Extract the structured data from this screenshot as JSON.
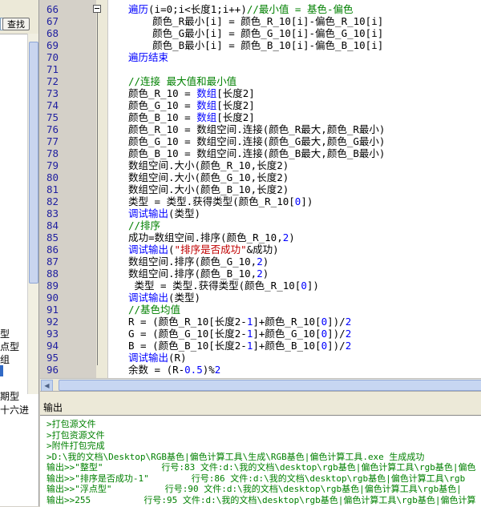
{
  "left_panel": {
    "find_button": "查找",
    "tree_items": [
      "型",
      "点型",
      "组",
      "",
      "",
      "期型",
      "十六进"
    ]
  },
  "editor": {
    "lines": [
      {
        "no": "66",
        "segs": [
          {
            "t": "遍历",
            "c": "kw"
          },
          {
            "t": "(i=0;i<长度1;i++)",
            "c": "plain"
          },
          {
            "t": "//最小值 = 基色-偏色",
            "c": "comment"
          }
        ]
      },
      {
        "no": "67",
        "segs": [
          {
            "t": "    颜色_R最小[i] = 颜色_R_10[i]-偏色_R_10[i]",
            "c": "plain"
          }
        ]
      },
      {
        "no": "68",
        "segs": [
          {
            "t": "    颜色_G最小[i] = 颜色_G_10[i]-偏色_G_10[i]",
            "c": "plain"
          }
        ]
      },
      {
        "no": "69",
        "segs": [
          {
            "t": "    颜色_B最小[i] = 颜色_B_10[i]-偏色_B_10[i]",
            "c": "plain"
          }
        ]
      },
      {
        "no": "70",
        "segs": [
          {
            "t": "遍历结束",
            "c": "kw"
          }
        ]
      },
      {
        "no": "71",
        "segs": []
      },
      {
        "no": "72",
        "segs": [
          {
            "t": "//连接 最大值和最小值",
            "c": "comment"
          }
        ]
      },
      {
        "no": "73",
        "segs": [
          {
            "t": "颜色_R_10 = ",
            "c": "plain"
          },
          {
            "t": "数组",
            "c": "kw"
          },
          {
            "t": "[长度2]",
            "c": "plain"
          }
        ]
      },
      {
        "no": "74",
        "segs": [
          {
            "t": "颜色_G_10 = ",
            "c": "plain"
          },
          {
            "t": "数组",
            "c": "kw"
          },
          {
            "t": "[长度2]",
            "c": "plain"
          }
        ]
      },
      {
        "no": "75",
        "segs": [
          {
            "t": "颜色_B_10 = ",
            "c": "plain"
          },
          {
            "t": "数组",
            "c": "kw"
          },
          {
            "t": "[长度2]",
            "c": "plain"
          }
        ]
      },
      {
        "no": "76",
        "segs": [
          {
            "t": "颜色_R_10 = 数组空间.连接(颜色_R最大,颜色_R最小)",
            "c": "plain"
          }
        ]
      },
      {
        "no": "77",
        "segs": [
          {
            "t": "颜色_G_10 = 数组空间.连接(颜色_G最大,颜色_G最小)",
            "c": "plain"
          }
        ]
      },
      {
        "no": "78",
        "segs": [
          {
            "t": "颜色_B_10 = 数组空间.连接(颜色_B最大,颜色_B最小)",
            "c": "plain"
          }
        ]
      },
      {
        "no": "79",
        "segs": [
          {
            "t": "数组空间.大小(颜色_R_10,长度2)",
            "c": "plain"
          }
        ]
      },
      {
        "no": "80",
        "segs": [
          {
            "t": "数组空间.大小(颜色_G_10,长度2)",
            "c": "plain"
          }
        ]
      },
      {
        "no": "81",
        "segs": [
          {
            "t": "数组空间.大小(颜色_B_10,长度2)",
            "c": "plain"
          }
        ]
      },
      {
        "no": "82",
        "segs": [
          {
            "t": "类型 = 类型.获得类型(颜色_R_10[",
            "c": "plain"
          },
          {
            "t": "0",
            "c": "num"
          },
          {
            "t": "])",
            "c": "plain"
          }
        ]
      },
      {
        "no": "83",
        "segs": [
          {
            "t": "调试输出",
            "c": "kw"
          },
          {
            "t": "(类型)",
            "c": "plain"
          }
        ]
      },
      {
        "no": "84",
        "segs": [
          {
            "t": "//排序",
            "c": "comment"
          }
        ]
      },
      {
        "no": "85",
        "segs": [
          {
            "t": "成功=数组空间.排序(颜色_R_10,",
            "c": "plain"
          },
          {
            "t": "2",
            "c": "num"
          },
          {
            "t": ")",
            "c": "plain"
          }
        ]
      },
      {
        "no": "86",
        "segs": [
          {
            "t": "调试输出",
            "c": "kw"
          },
          {
            "t": "(",
            "c": "plain"
          },
          {
            "t": "\"排序是否成功\"",
            "c": "str"
          },
          {
            "t": "&成功)",
            "c": "plain"
          }
        ]
      },
      {
        "no": "87",
        "segs": [
          {
            "t": "数组空间.排序(颜色_G_10,",
            "c": "plain"
          },
          {
            "t": "2",
            "c": "num"
          },
          {
            "t": ")",
            "c": "plain"
          }
        ]
      },
      {
        "no": "88",
        "segs": [
          {
            "t": "数组空间.排序(颜色_B_10,",
            "c": "plain"
          },
          {
            "t": "2",
            "c": "num"
          },
          {
            "t": ")",
            "c": "plain"
          }
        ]
      },
      {
        "no": "89",
        "segs": [
          {
            "t": " 类型 = 类型.获得类型(颜色_R_10[",
            "c": "plain"
          },
          {
            "t": "0",
            "c": "num"
          },
          {
            "t": "])",
            "c": "plain"
          }
        ]
      },
      {
        "no": "90",
        "segs": [
          {
            "t": "调试输出",
            "c": "kw"
          },
          {
            "t": "(类型)",
            "c": "plain"
          }
        ]
      },
      {
        "no": "91",
        "segs": [
          {
            "t": "//基色均值",
            "c": "comment"
          }
        ]
      },
      {
        "no": "92",
        "segs": [
          {
            "t": "R = (颜色_R_10[长度2-",
            "c": "plain"
          },
          {
            "t": "1",
            "c": "num"
          },
          {
            "t": "]+颜色_R_10[",
            "c": "plain"
          },
          {
            "t": "0",
            "c": "num"
          },
          {
            "t": "])/",
            "c": "plain"
          },
          {
            "t": "2",
            "c": "num"
          }
        ]
      },
      {
        "no": "93",
        "segs": [
          {
            "t": "G = (颜色_G_10[长度2-",
            "c": "plain"
          },
          {
            "t": "1",
            "c": "num"
          },
          {
            "t": "]+颜色_G_10[",
            "c": "plain"
          },
          {
            "t": "0",
            "c": "num"
          },
          {
            "t": "])/",
            "c": "plain"
          },
          {
            "t": "2",
            "c": "num"
          }
        ]
      },
      {
        "no": "94",
        "segs": [
          {
            "t": "B = (颜色_B_10[长度2-",
            "c": "plain"
          },
          {
            "t": "1",
            "c": "num"
          },
          {
            "t": "]+颜色_B_10[",
            "c": "plain"
          },
          {
            "t": "0",
            "c": "num"
          },
          {
            "t": "])/",
            "c": "plain"
          },
          {
            "t": "2",
            "c": "num"
          }
        ]
      },
      {
        "no": "95",
        "segs": [
          {
            "t": "调试输出",
            "c": "kw"
          },
          {
            "t": "(R)",
            "c": "plain"
          }
        ]
      },
      {
        "no": "96",
        "segs": [
          {
            "t": "余数 = (R-",
            "c": "plain"
          },
          {
            "t": "0.5",
            "c": "num"
          },
          {
            "t": ")%",
            "c": "plain"
          },
          {
            "t": "2",
            "c": "num"
          }
        ]
      }
    ]
  },
  "output": {
    "title": "输出",
    "lines": [
      ">打包源文件",
      ">打包资源文件",
      ">附件打包完成",
      ">D:\\我的文档\\Desktop\\RGB基色|偏色计算工具\\生成\\RGB基色|偏色计算工具.exe 生成成功",
      "输出>>\"整型\"           行号:83 文件:d:\\我的文档\\desktop\\rgb基色|偏色计算工具\\rgb基色|偏色",
      "输出>>\"排序是否成功-1\"        行号:86 文件:d:\\我的文档\\desktop\\rgb基色|偏色计算工具\\rgb",
      "输出>>\"浮点型\"          行号:90 文件:d:\\我的文档\\desktop\\rgb基色|偏色计算工具\\rgb基色|",
      "输出>>255          行号:95 文件:d:\\我的文档\\desktop\\rgb基色|偏色计算工具\\rgb基色|偏色计算"
    ]
  },
  "colors": {
    "keyword": "#0000ff",
    "comment": "#008000",
    "string": "#c00000",
    "line_number": "#2020a0",
    "output_text": "#008000"
  }
}
